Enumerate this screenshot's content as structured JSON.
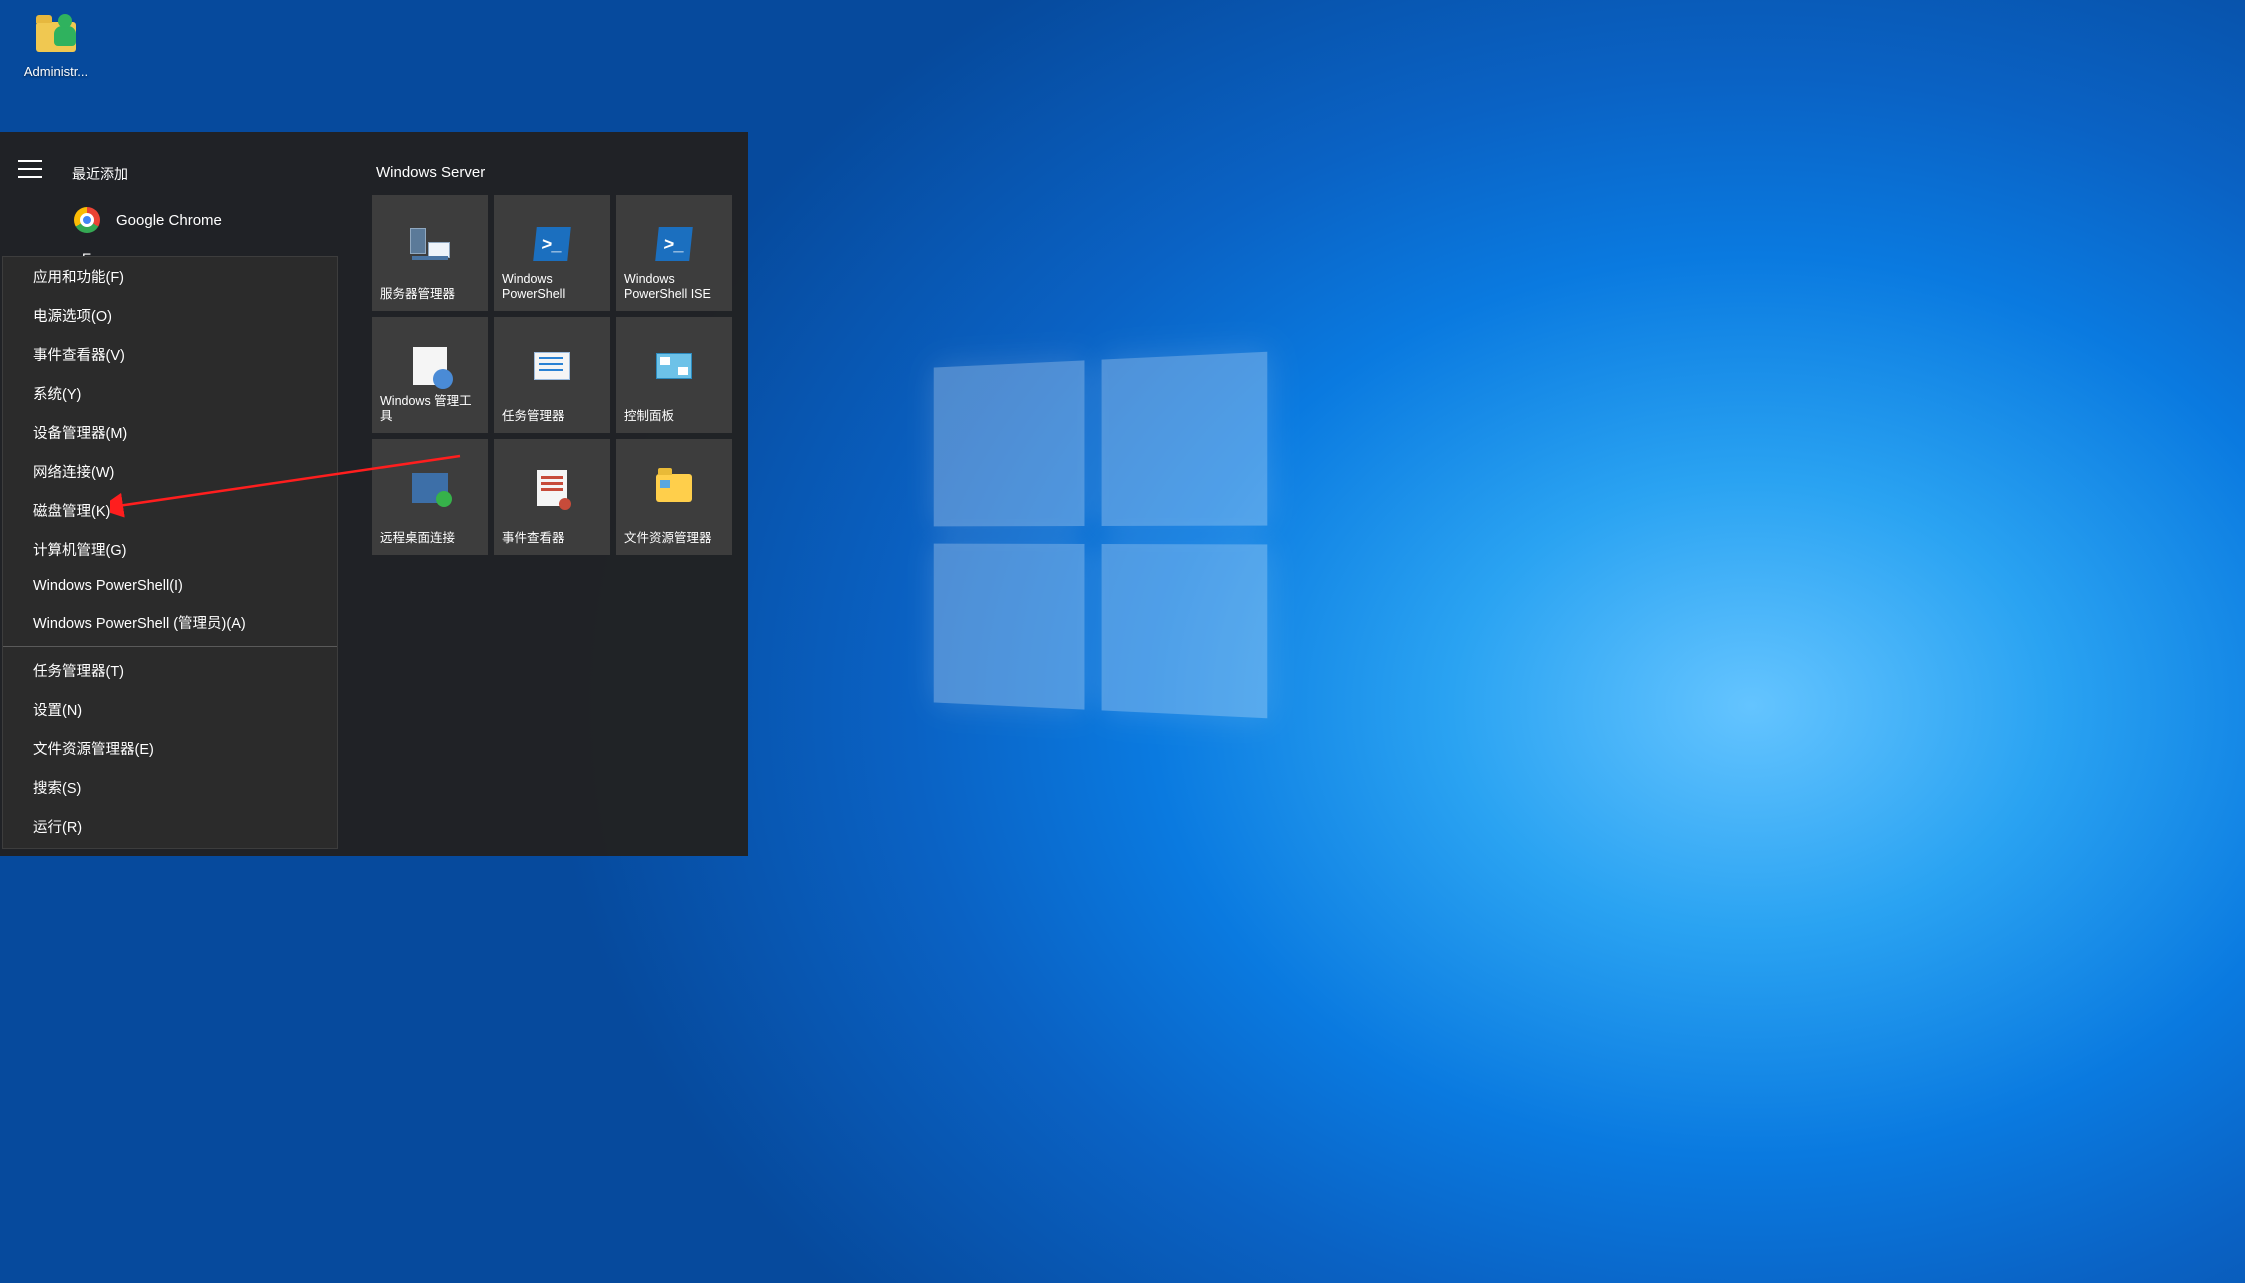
{
  "desktop_icons": [
    {
      "name": "administrator-shortcut",
      "label": "Administr..."
    }
  ],
  "start_menu": {
    "recent_header": "最近添加",
    "recent_apps": [
      {
        "name": "google-chrome",
        "label": "Google Chrome"
      }
    ],
    "index_letter": "E",
    "tiles_group_title": "Windows Server",
    "tiles": [
      {
        "name": "server-manager",
        "label": "服务器管理器",
        "icon": "server-manager-icon"
      },
      {
        "name": "powershell",
        "label": "Windows PowerShell",
        "icon": "powershell-icon"
      },
      {
        "name": "powershell-ise",
        "label": "Windows PowerShell ISE",
        "icon": "powershell-ise-icon"
      },
      {
        "name": "admin-tools",
        "label": "Windows 管理工具",
        "icon": "admin-tools-icon"
      },
      {
        "name": "task-manager",
        "label": "任务管理器",
        "icon": "task-manager-icon"
      },
      {
        "name": "control-panel",
        "label": "控制面板",
        "icon": "control-panel-icon"
      },
      {
        "name": "remote-desktop",
        "label": "远程桌面连接",
        "icon": "remote-desktop-icon"
      },
      {
        "name": "event-viewer",
        "label": "事件查看器",
        "icon": "event-viewer-icon"
      },
      {
        "name": "file-explorer",
        "label": "文件资源管理器",
        "icon": "file-explorer-icon"
      }
    ]
  },
  "winx_menu": {
    "groups": [
      [
        {
          "name": "apps-features",
          "label": "应用和功能(F)"
        },
        {
          "name": "power-options",
          "label": "电源选项(O)"
        },
        {
          "name": "event-viewer",
          "label": "事件查看器(V)"
        },
        {
          "name": "system",
          "label": "系统(Y)"
        },
        {
          "name": "device-manager",
          "label": "设备管理器(M)"
        },
        {
          "name": "network-connections",
          "label": "网络连接(W)"
        },
        {
          "name": "disk-management",
          "label": "磁盘管理(K)"
        },
        {
          "name": "computer-management",
          "label": "计算机管理(G)"
        },
        {
          "name": "powershell",
          "label": "Windows PowerShell(I)"
        },
        {
          "name": "powershell-admin",
          "label": "Windows PowerShell (管理员)(A)"
        }
      ],
      [
        {
          "name": "task-manager",
          "label": "任务管理器(T)"
        },
        {
          "name": "settings",
          "label": "设置(N)"
        },
        {
          "name": "file-explorer",
          "label": "文件资源管理器(E)"
        },
        {
          "name": "search",
          "label": "搜索(S)"
        },
        {
          "name": "run",
          "label": "运行(R)"
        }
      ]
    ]
  },
  "annotation": {
    "target": "disk-management"
  }
}
